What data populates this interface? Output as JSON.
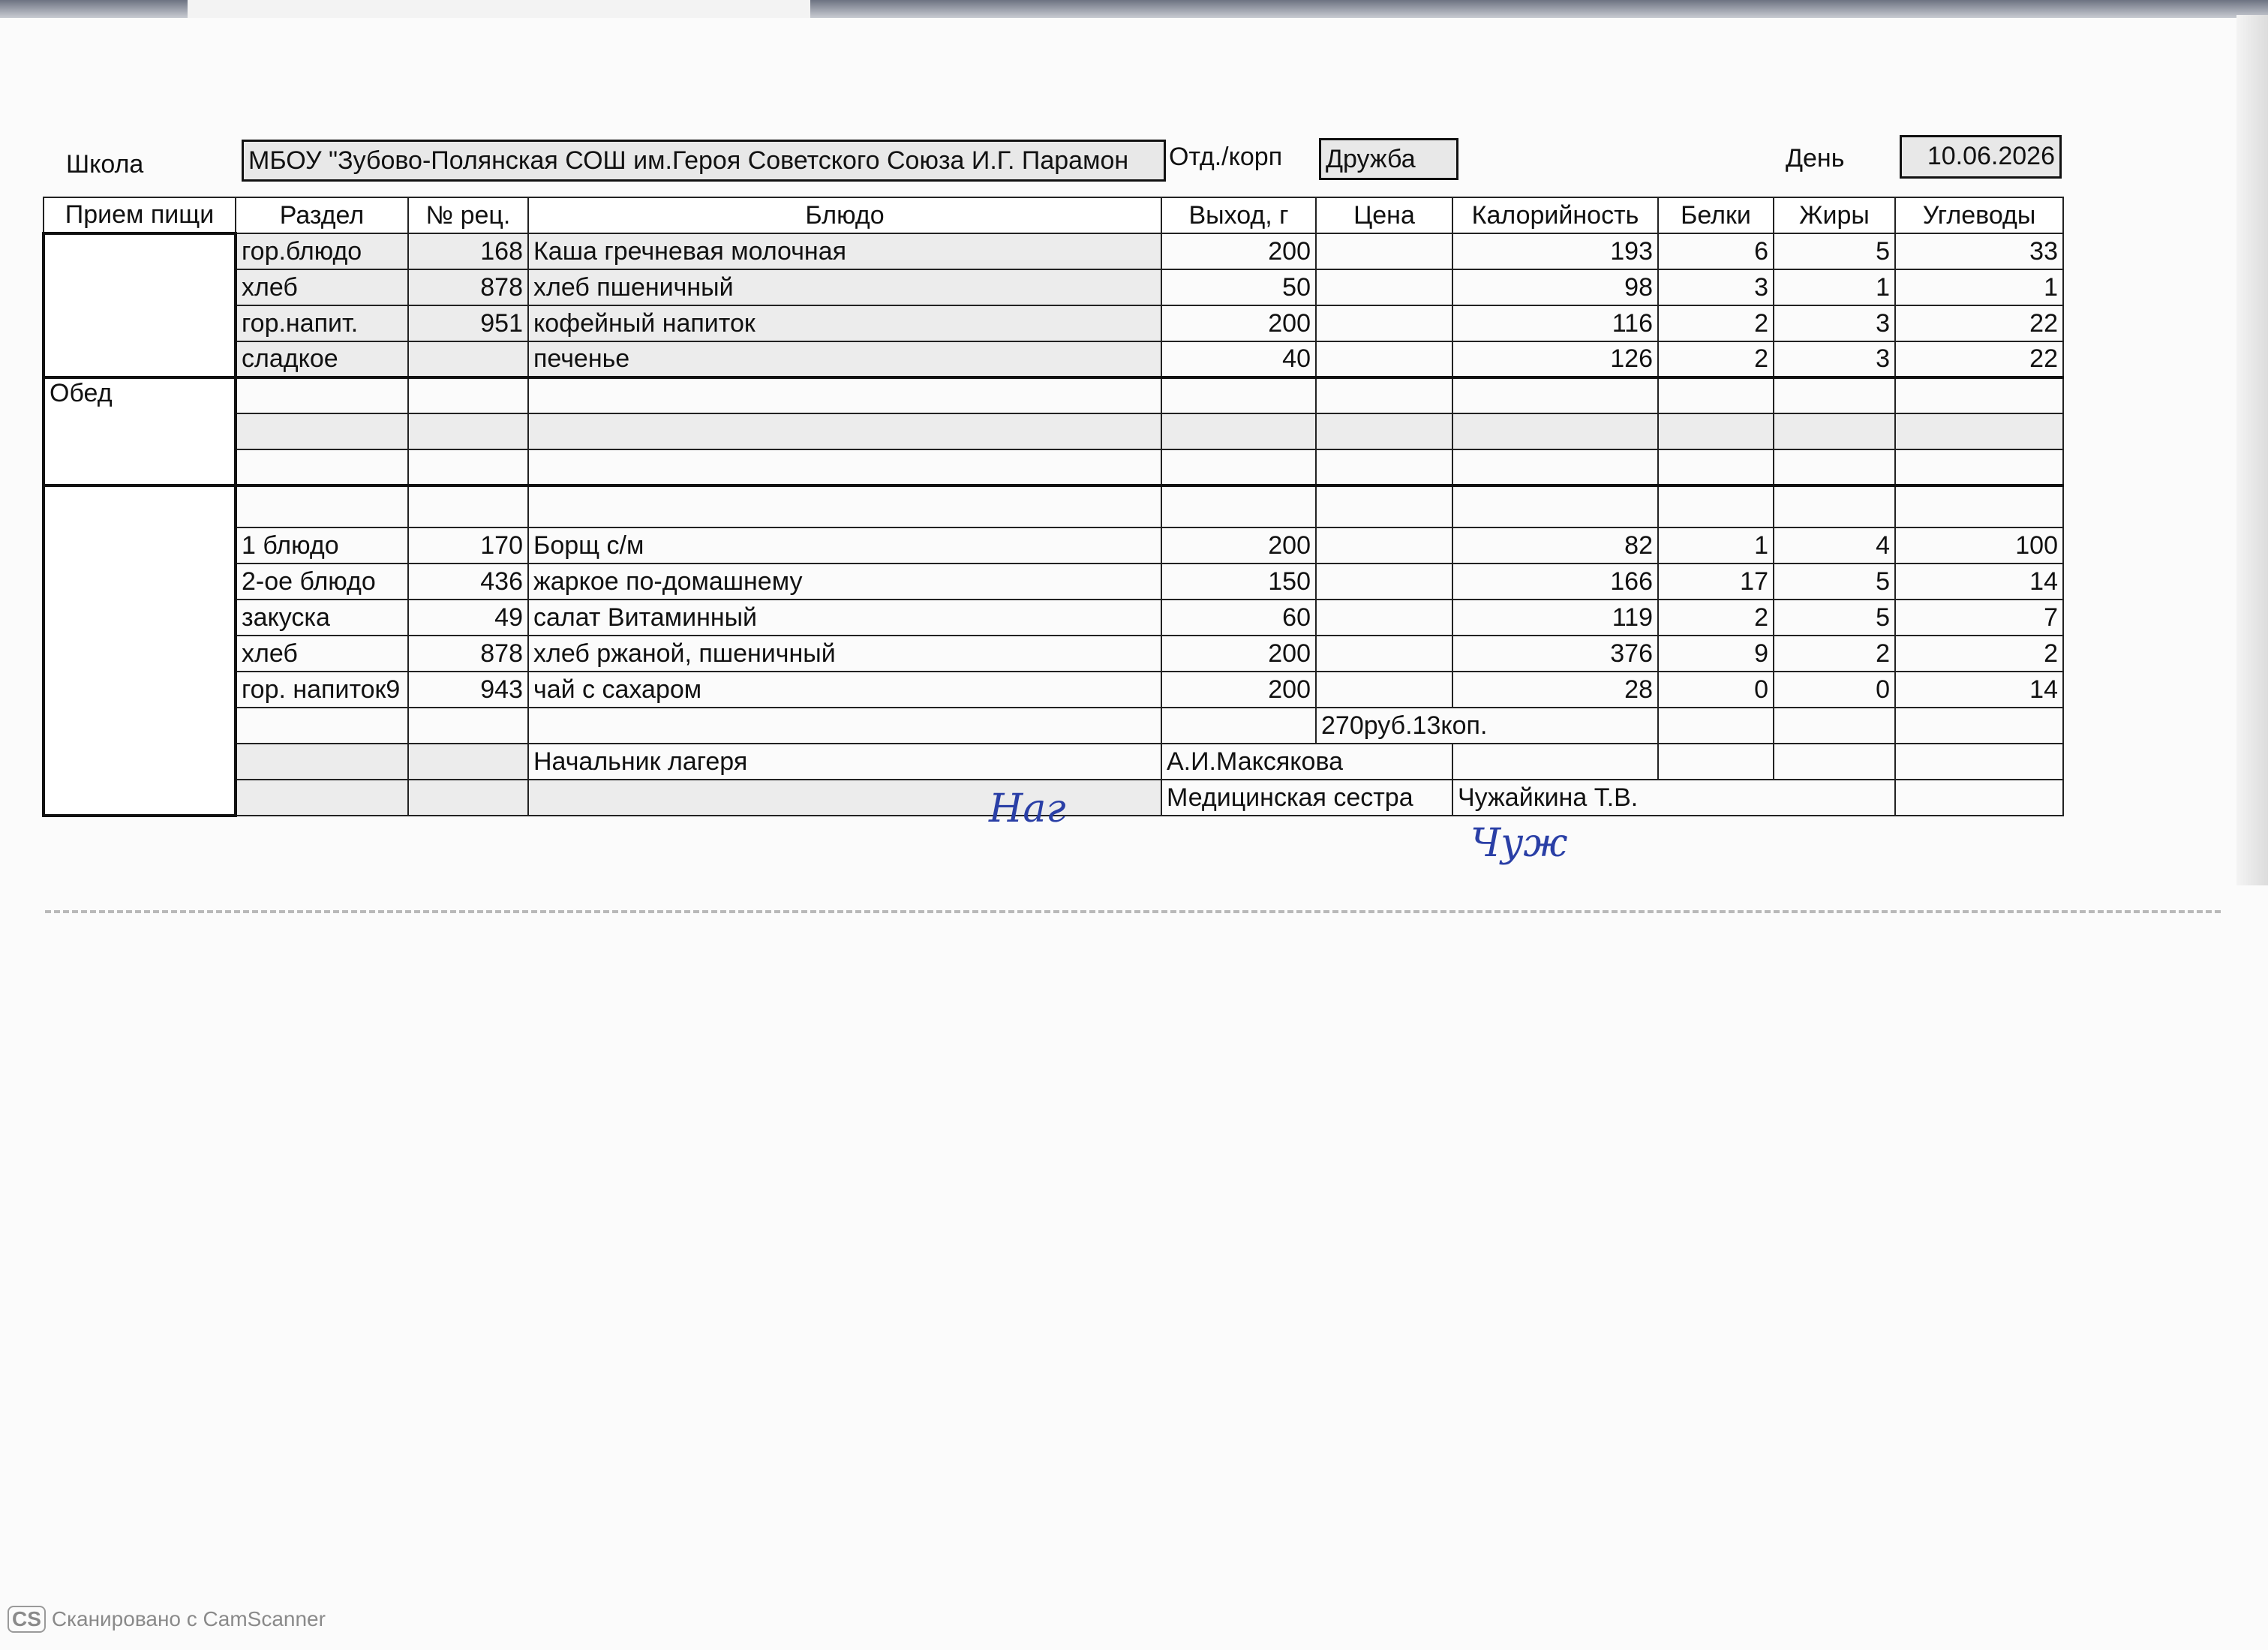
{
  "header": {
    "school_label": "Школа",
    "school_value": "МБОУ \"Зубово-Полянская СОШ им.Героя Советского Союза И.Г. Парамон",
    "dept_label": "Отд./корп",
    "dept_value": "Дружба",
    "day_label": "День",
    "day_value": "10.06.2026"
  },
  "columns": [
    "Прием пищи",
    "Раздел",
    "№ рец.",
    "Блюдо",
    "Выход, г",
    "Цена",
    "Калорийность",
    "Белки",
    "Жиры",
    "Углеводы"
  ],
  "breakfast": {
    "rows": [
      {
        "section": "гор.блюдо",
        "recipe": "168",
        "dish": "Каша гречневая молочная",
        "weight": "200",
        "price": "",
        "cal": "193",
        "protein": "6",
        "fat": "5",
        "carbs": "33"
      },
      {
        "section": "хлеб",
        "recipe": "878",
        "dish": "хлеб пшеничный",
        "weight": "50",
        "price": "",
        "cal": "98",
        "protein": "3",
        "fat": "1",
        "carbs": "1"
      },
      {
        "section": "гор.напит.",
        "recipe": "951",
        "dish": "кофейный напиток",
        "weight": "200",
        "price": "",
        "cal": "116",
        "protein": "2",
        "fat": "3",
        "carbs": "22"
      },
      {
        "section": "сладкое",
        "recipe": "",
        "dish": "печенье",
        "weight": "40",
        "price": "",
        "cal": "126",
        "protein": "2",
        "fat": "3",
        "carbs": "22"
      }
    ]
  },
  "dinner": {
    "label": "Обед"
  },
  "lunch": {
    "rows": [
      {
        "section": "1 блюдо",
        "recipe": "170",
        "dish": "Борщ с/м",
        "weight": "200",
        "price": "",
        "cal": "82",
        "protein": "1",
        "fat": "4",
        "carbs": "100"
      },
      {
        "section": "2-ое блюдо",
        "recipe": "436",
        "dish": "жаркое по-домашнему",
        "weight": "150",
        "price": "",
        "cal": "166",
        "protein": "17",
        "fat": "5",
        "carbs": "14"
      },
      {
        "section": "закуска",
        "recipe": "49",
        "dish": "салат Витаминный",
        "weight": "60",
        "price": "",
        "cal": "119",
        "protein": "2",
        "fat": "5",
        "carbs": "7"
      },
      {
        "section": "хлеб",
        "recipe": "878",
        "dish": "хлеб ржаной, пшеничный",
        "weight": "200",
        "price": "",
        "cal": "376",
        "protein": "9",
        "fat": "2",
        "carbs": "2"
      },
      {
        "section": "гор. напиток9",
        "recipe": "943",
        "dish": "чай с сахаром",
        "weight": "200",
        "price": "",
        "cal": "28",
        "protein": "0",
        "fat": "0",
        "carbs": "14"
      }
    ],
    "total_price": "270руб.13коп."
  },
  "signatures": {
    "head_label": "Начальник лагеря",
    "head_name": "А.И.Максякова",
    "head_sign": "Наг",
    "nurse_label": "Медицинская сестра",
    "nurse_name": "Чужайкина Т.В.",
    "nurse_sign": "Чуж"
  },
  "scanner": {
    "logo": "CS",
    "text": "Сканировано с CamScanner"
  }
}
